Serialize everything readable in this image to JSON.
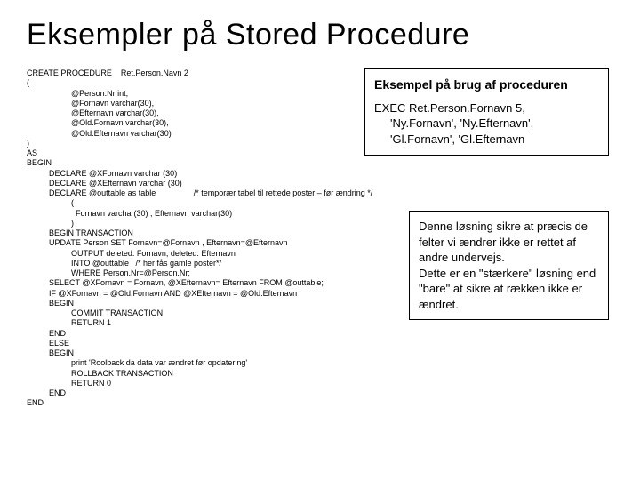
{
  "title": "Eksempler på Stored Procedure",
  "code": "CREATE PROCEDURE    Ret.Person.Navn 2\n(\n                    @Person.Nr int,\n                    @Fornavn varchar(30),\n                    @Efternavn varchar(30),\n                    @Old.Fornavn varchar(30),\n                    @Old.Efternavn varchar(30)\n)\nAS\nBEGIN\n          DECLARE @XFornavn varchar (30)\n          DECLARE @XEfternavn varchar (30)\n          DECLARE @outtable as table                 /* temporær tabel til rettede poster – før ændring */\n                    (\n                      Fornavn varchar(30) , Efternavn varchar(30)\n                    )\n          BEGIN TRANSACTION\n          UPDATE Person SET Fornavn=@Fornavn , Efternavn=@Efternavn\n                    OUTPUT deleted. Fornavn, deleted. Efternavn\n                    INTO @outtable   /* her fås gamle poster*/\n                    WHERE Person.Nr=@Person.Nr;\n          SELECT @XFornavn = Fornavn, @XEfternavn= Efternavn FROM @outtable;\n          IF @XFornavn = @Old.Fornavn AND @XEfternavn = @Old.Efternavn\n          BEGIN\n                    COMMIT TRANSACTION\n                    RETURN 1\n          END\n          ELSE\n          BEGIN\n                    print 'Roolback da data var ændret før opdatering'\n                    ROLLBACK TRANSACTION\n                    RETURN 0\n          END\nEND",
  "box1": {
    "header": "Eksempel på brug af proceduren",
    "body": "EXEC Ret.Person.Fornavn 5,\n     'Ny.Fornavn', 'Ny.Efternavn',\n     'Gl.Fornavn', 'Gl.Efternavn"
  },
  "box2": {
    "body": "Denne løsning sikre at præcis de felter vi ændrer ikke er rettet af andre undervejs.\nDette er en \"stærkere\" løsning end \"bare\" at sikre at rækken ikke er ændret."
  }
}
